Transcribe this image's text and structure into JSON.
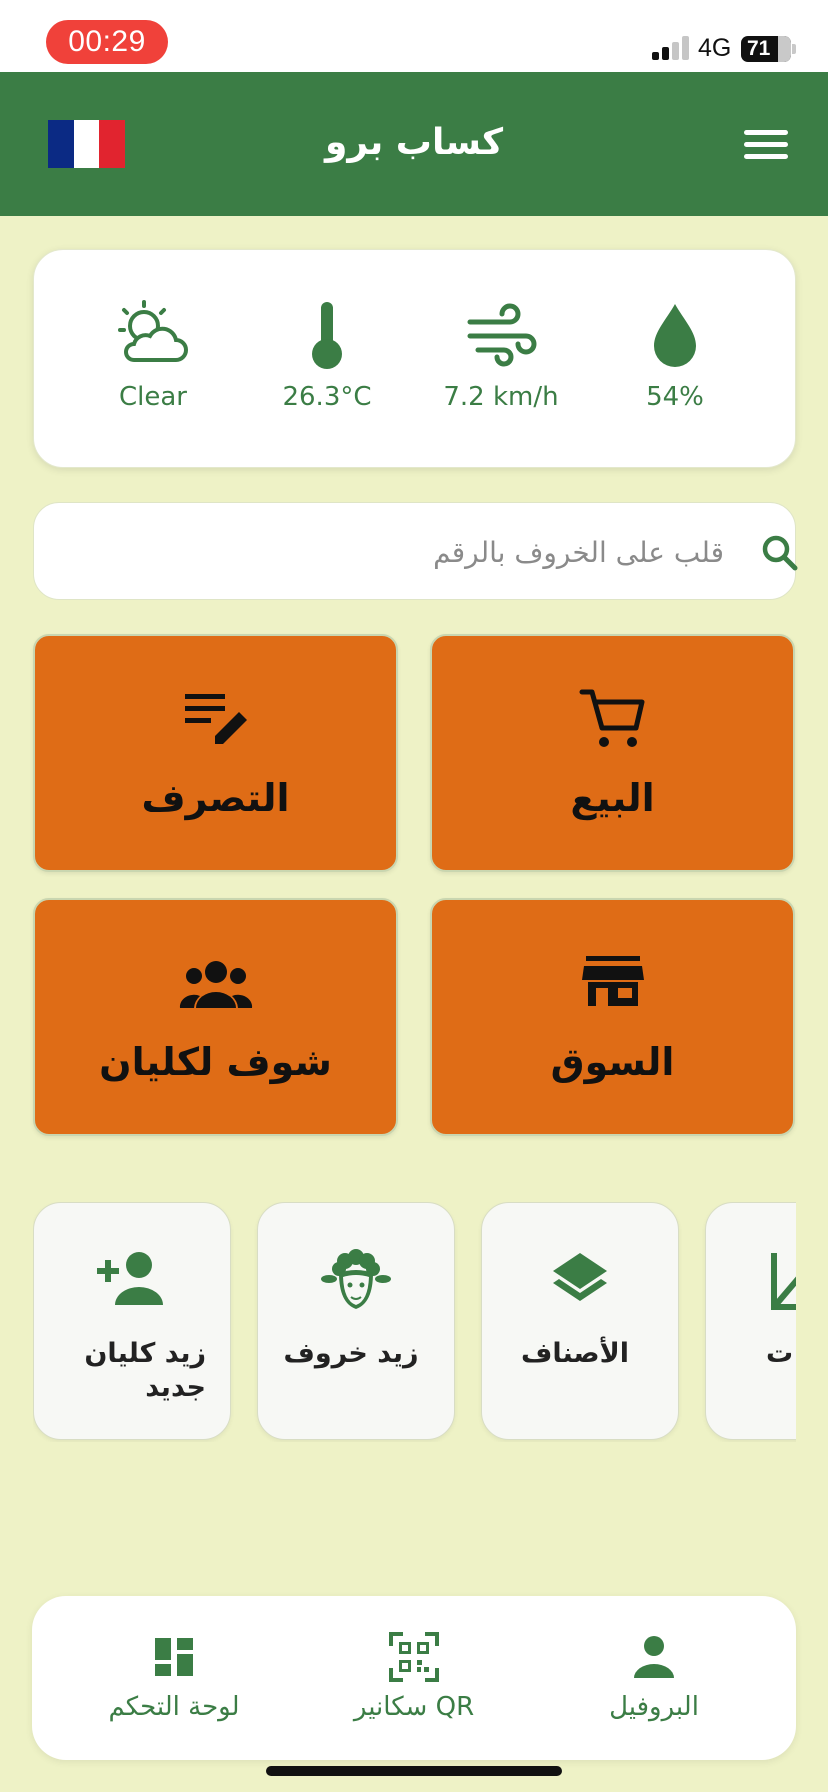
{
  "status_bar": {
    "time": "00:29",
    "network": "4G",
    "battery": "71",
    "battery_level_percent": 71,
    "signal_bars_active": 2,
    "signal_bars_total": 4
  },
  "header": {
    "title": "كساب برو",
    "flag": "france-flag",
    "flag_colors": [
      "#0b2a84",
      "#ffffff",
      "#e1242f"
    ],
    "menu_icon": "hamburger-menu-icon"
  },
  "weather": {
    "condition": "Clear",
    "temperature": "26.3°C",
    "wind": "7.2 km/h",
    "humidity": "54%",
    "icons": [
      "sun-cloud-icon",
      "thermometer-icon",
      "wind-icon",
      "water-drop-icon"
    ]
  },
  "search": {
    "placeholder": "قلب على الخروف بالرقم",
    "value": ""
  },
  "tiles": {
    "sell": "البيع",
    "manage": "التصرف",
    "market": "السوق",
    "clients": "شوف لكليان"
  },
  "shortcuts": {
    "add_client": "زيد كليان جديد",
    "add_sheep": "زيد خروف",
    "categories": "الأصناف",
    "partial": "ت"
  },
  "bottom_nav": {
    "profile": "البروفيل",
    "qr_scanner": "سكانير QR",
    "dashboard": "لوحة التحكم"
  },
  "colors": {
    "primary_green": "#3b7d45",
    "tile_orange": "#df6c16",
    "background": "#eef2c6",
    "time_pill_red": "#f0413a"
  }
}
